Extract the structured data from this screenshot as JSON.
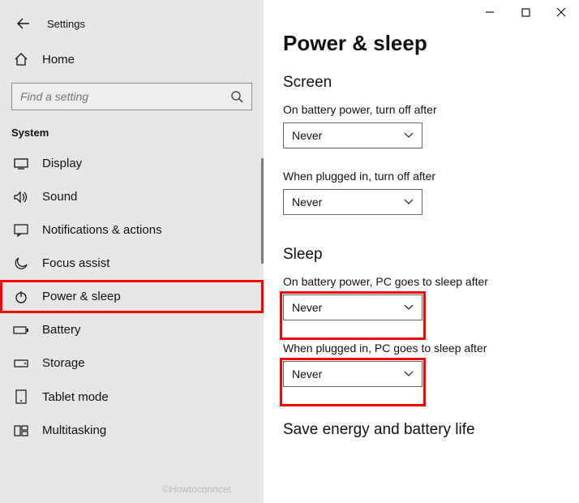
{
  "window": {
    "title": "Settings"
  },
  "sidebar": {
    "home": "Home",
    "search_placeholder": "Find a setting",
    "section": "System",
    "items": [
      {
        "label": "Display"
      },
      {
        "label": "Sound"
      },
      {
        "label": "Notifications & actions"
      },
      {
        "label": "Focus assist"
      },
      {
        "label": "Power & sleep"
      },
      {
        "label": "Battery"
      },
      {
        "label": "Storage"
      },
      {
        "label": "Tablet mode"
      },
      {
        "label": "Multitasking"
      }
    ]
  },
  "content": {
    "page_title": "Power & sleep",
    "screen": {
      "title": "Screen",
      "battery_label": "On battery power, turn off after",
      "battery_value": "Never",
      "plugged_label": "When plugged in, turn off after",
      "plugged_value": "Never"
    },
    "sleep": {
      "title": "Sleep",
      "battery_label": "On battery power, PC goes to sleep after",
      "battery_value": "Never",
      "plugged_label": "When plugged in, PC goes to sleep after",
      "plugged_value": "Never"
    },
    "bottom_heading": "Save energy and battery life"
  },
  "watermark": "©Howtoconncet"
}
